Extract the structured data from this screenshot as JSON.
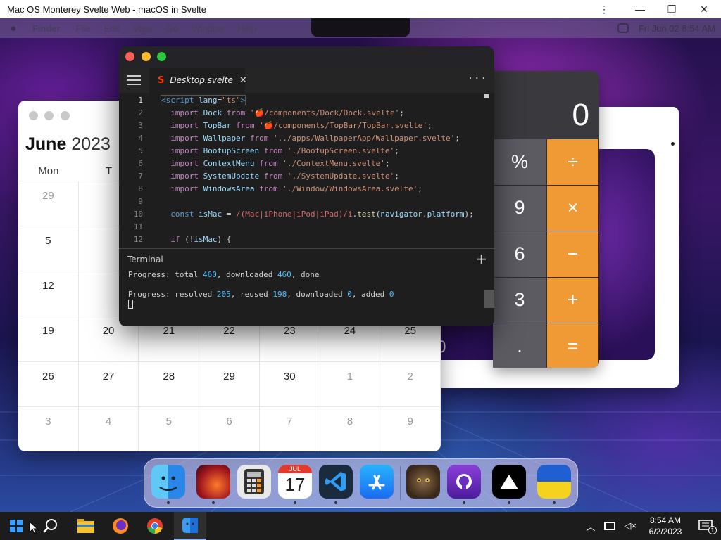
{
  "browser": {
    "title": "Mac OS Monterey Svelte Web - macOS in Svelte",
    "more_icon": "⋮",
    "min_icon": "—",
    "max_icon": "❐",
    "close_icon": "✕"
  },
  "menubar": {
    "app": "Finder",
    "items": [
      "File",
      "Edit",
      "View",
      "Go",
      "Window",
      "Help"
    ],
    "datetime": "Fri Jun 02  8:54 AM"
  },
  "calendar": {
    "month": "June",
    "year": "2023",
    "weekdays": [
      "Mon",
      "T",
      "",
      "",
      "",
      "",
      ""
    ],
    "rows": [
      [
        "29",
        "",
        "",
        "",
        "",
        "",
        ""
      ],
      [
        "5",
        "",
        "",
        "",
        "",
        "",
        ""
      ],
      [
        "12",
        "",
        "",
        "",
        "",
        "",
        ""
      ],
      [
        "19",
        "20",
        "21",
        "22",
        "23",
        "24",
        "25"
      ],
      [
        "26",
        "27",
        "28",
        "29",
        "30",
        "1",
        "2"
      ],
      [
        "3",
        "4",
        "5",
        "6",
        "7",
        "8",
        "9"
      ]
    ]
  },
  "calculator": {
    "display": "0",
    "keys": [
      "%",
      "÷",
      "9",
      "×",
      "6",
      "−",
      "3",
      "+",
      ".",
      "="
    ]
  },
  "back_window": {
    "partial_digit": "0"
  },
  "editor": {
    "tab": "Desktop.svelte",
    "tab_close": "✕",
    "more": "···",
    "line_numbers": [
      "1",
      "2",
      "3",
      "4",
      "5",
      "6",
      "7",
      "8",
      "9",
      "10",
      "11",
      "12"
    ],
    "lines": [
      "<script lang=\"ts\">",
      "  import Dock from '🍎/components/Dock/Dock.svelte';",
      "  import TopBar from '🍎/components/TopBar/TopBar.svelte';",
      "  import Wallpaper from '../apps/WallpaperApp/Wallpaper.svelte';",
      "  import BootupScreen from './BootupScreen.svelte';",
      "  import ContextMenu from './ContextMenu.svelte';",
      "  import SystemUpdate from './SystemUpdate.svelte';",
      "  import WindowsArea from './Window/WindowsArea.svelte';",
      "",
      "  const isMac = /(Mac|iPhone|iPod|iPad)/i.test(navigator.platform);",
      "",
      "  if (!isMac) {"
    ],
    "terminal_title": "Terminal",
    "terminal_plus": "+",
    "terminal_lines": [
      {
        "a": "Progress: total ",
        "n1": "460",
        "b": ", downloaded ",
        "n2": "460",
        "c": ", done"
      },
      {
        "a": "Progress: resolved ",
        "n1": "205",
        "b": ", reused ",
        "n2": "198",
        "c": ", downloaded ",
        "n3": "0",
        "d": ", added ",
        "n4": "0"
      }
    ]
  },
  "dock": {
    "apps": [
      "finder-icon",
      "launchpad-icon",
      "calculator-icon",
      "calendar-icon",
      "vscode-icon",
      "appstore-icon",
      "cat-photo-icon",
      "github-icon",
      "vercel-icon",
      "ukraine-flag-icon"
    ],
    "calendar_month": "JUL",
    "calendar_day": "17"
  },
  "taskbar": {
    "time": "8:54 AM",
    "date": "6/2/2023",
    "notifications": "1"
  },
  "colors": {
    "svelte": "#ff3e00",
    "calc_op": "#f09a36",
    "tl_red": "#ff5f57",
    "tl_yellow": "#febc2e",
    "tl_green": "#28c840"
  }
}
